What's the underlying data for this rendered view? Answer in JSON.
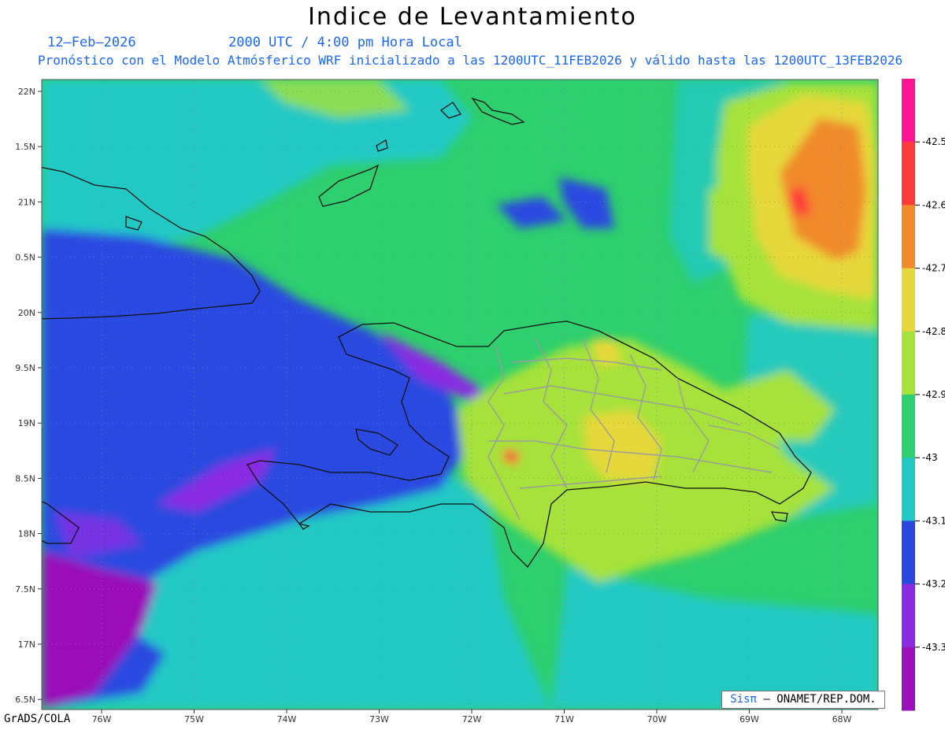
{
  "header": {
    "title": "Indice de Levantamiento",
    "date": "12–Feb–2026",
    "time": "2000 UTC / 4:00 pm Hora Local",
    "subtitle": "Pronóstico con el Modelo Atmósferico WRF inicializado a las 1200UTC_11FEB2026 y válido hasta las  1200UTC_13FEB2026"
  },
  "map": {
    "lat_labels": [
      "22N",
      "1.5N",
      "21N",
      "0.5N",
      "20N",
      "9.5N",
      "19N",
      "8.5N",
      "18N",
      "7.5N",
      "17N",
      "6.5N"
    ],
    "lon_labels": [
      "76W",
      "75W",
      "74W",
      "73W",
      "72W",
      "71W",
      "70W",
      "69W",
      "68W"
    ],
    "grid": true
  },
  "colorbar": {
    "labels": [
      "-42.5",
      "-42.6",
      "-42.7",
      "-42.8",
      "-42.9",
      "-43",
      "-43.1",
      "-43.2",
      "-43.3"
    ],
    "colors": [
      "#ff1493",
      "#ff3a3a",
      "#f08a2a",
      "#e6d83a",
      "#a6e23a",
      "#2ecf6e",
      "#22c9c4",
      "#2a48e0",
      "#8a2be2",
      "#9a11b8"
    ]
  },
  "footer": {
    "credit": "GrADS/COLA",
    "logo_brand": "Sisπ",
    "logo_text": "– ONAMET/REP.DOM."
  }
}
